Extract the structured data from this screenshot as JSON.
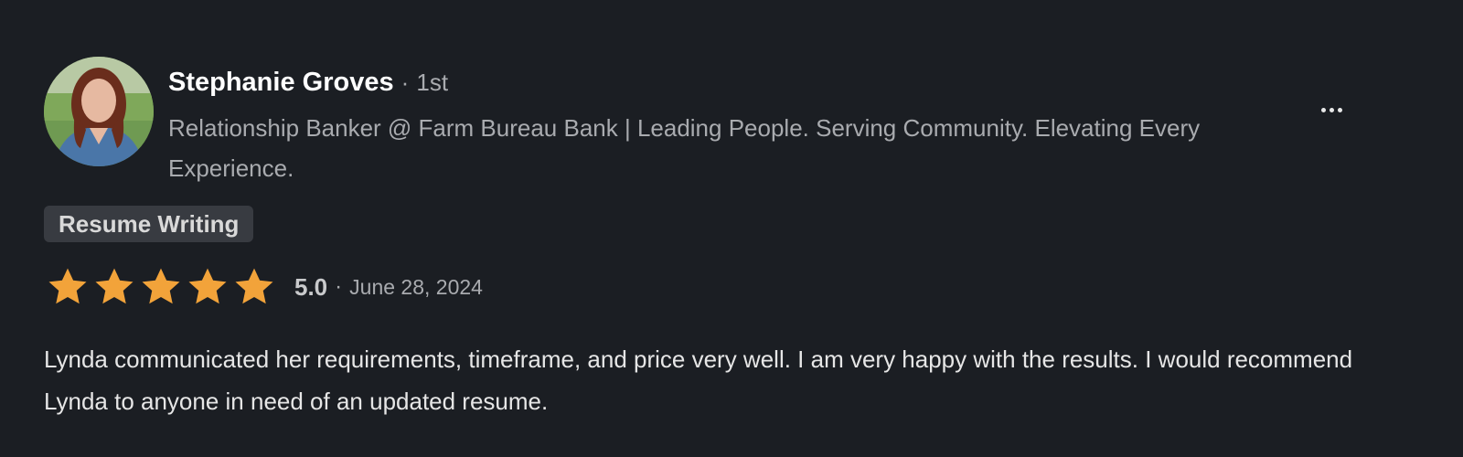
{
  "review": {
    "reviewer": {
      "name": "Stephanie Groves",
      "separator": "·",
      "connection_degree": "1st",
      "headline": "Relationship Banker @ Farm Bureau Bank | Leading People. Serving Community. Elevating Every Experience."
    },
    "more_options_icon": "more-horizontal-icon",
    "service_tag": "Resume Writing",
    "rating": {
      "stars": 5,
      "max_stars": 5,
      "score": "5.0",
      "separator": "·",
      "date": "June 28, 2024",
      "star_icon": "star-icon",
      "star_color": "#f2a33a"
    },
    "text": "Lynda communicated her requirements, timeframe, and price very well. I am very happy with the results. I would recommend Lynda to anyone in need of an updated resume."
  },
  "colors": {
    "background": "#1b1e23",
    "primary_text": "#ffffff",
    "secondary_text": "#a9abaf",
    "tag_background": "#383b41",
    "star": "#f2a33a"
  }
}
